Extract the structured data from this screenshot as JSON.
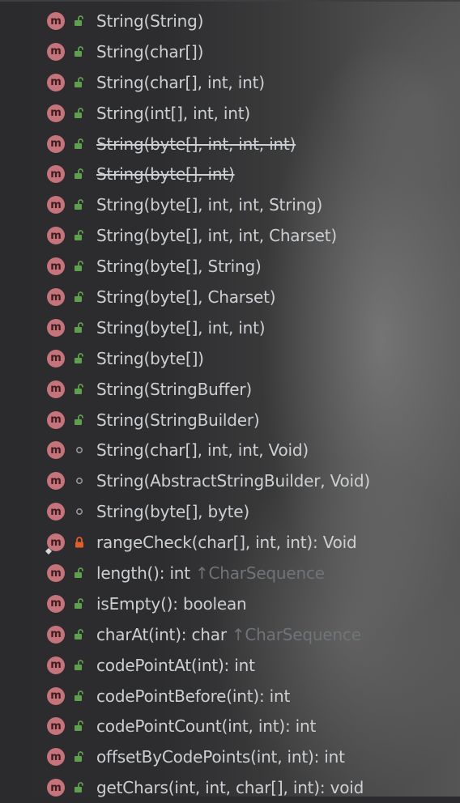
{
  "colors": {
    "method_icon_bg": "#c4747a",
    "public_green": "#5fa04e",
    "private_orange": "#e05d2c",
    "text": "#cdd0d3",
    "hint": "#6f7478"
  },
  "methods": [
    {
      "label": "String(String)",
      "visibility": "public",
      "deprecated": false
    },
    {
      "label": "String(char[])",
      "visibility": "public",
      "deprecated": false
    },
    {
      "label": "String(char[], int, int)",
      "visibility": "public",
      "deprecated": false
    },
    {
      "label": "String(int[], int, int)",
      "visibility": "public",
      "deprecated": false
    },
    {
      "label": "String(byte[], int, int, int)",
      "visibility": "public",
      "deprecated": true
    },
    {
      "label": "String(byte[], int)",
      "visibility": "public",
      "deprecated": true
    },
    {
      "label": "String(byte[], int, int, String)",
      "visibility": "public",
      "deprecated": false
    },
    {
      "label": "String(byte[], int, int, Charset)",
      "visibility": "public",
      "deprecated": false
    },
    {
      "label": "String(byte[], String)",
      "visibility": "public",
      "deprecated": false
    },
    {
      "label": "String(byte[], Charset)",
      "visibility": "public",
      "deprecated": false
    },
    {
      "label": "String(byte[], int, int)",
      "visibility": "public",
      "deprecated": false
    },
    {
      "label": "String(byte[])",
      "visibility": "public",
      "deprecated": false
    },
    {
      "label": "String(StringBuffer)",
      "visibility": "public",
      "deprecated": false
    },
    {
      "label": "String(StringBuilder)",
      "visibility": "public",
      "deprecated": false
    },
    {
      "label": "String(char[], int, int, Void)",
      "visibility": "package",
      "deprecated": false
    },
    {
      "label": "String(AbstractStringBuilder, Void)",
      "visibility": "package",
      "deprecated": false
    },
    {
      "label": "String(byte[], byte)",
      "visibility": "package",
      "deprecated": false
    },
    {
      "label": "rangeCheck(char[], int, int): Void",
      "visibility": "private",
      "deprecated": false,
      "override_marker": true
    },
    {
      "label": "length(): int",
      "visibility": "public",
      "deprecated": false,
      "hint": "CharSequence"
    },
    {
      "label": "isEmpty(): boolean",
      "visibility": "public",
      "deprecated": false
    },
    {
      "label": "charAt(int): char",
      "visibility": "public",
      "deprecated": false,
      "hint": "CharSequence"
    },
    {
      "label": "codePointAt(int): int",
      "visibility": "public",
      "deprecated": false
    },
    {
      "label": "codePointBefore(int): int",
      "visibility": "public",
      "deprecated": false
    },
    {
      "label": "codePointCount(int, int): int",
      "visibility": "public",
      "deprecated": false
    },
    {
      "label": "offsetByCodePoints(int, int): int",
      "visibility": "public",
      "deprecated": false
    },
    {
      "label": "getChars(int, int, char[], int): void",
      "visibility": "public",
      "deprecated": false
    }
  ],
  "icon_letter": "m",
  "hint_arrow": "↑"
}
